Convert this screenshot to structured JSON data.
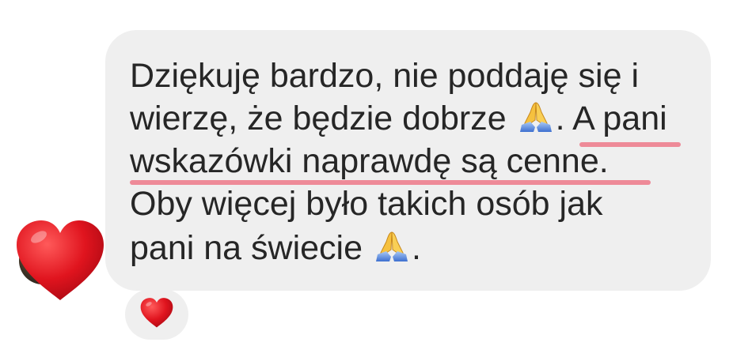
{
  "message": {
    "line1": "Dziękuję bardzo, nie poddaję się i",
    "line2_before": "wierzę, że będzie dobrze ",
    "line2_after": ". A pani",
    "line3": "wskazówki naprawdę są cenne.",
    "line4": "Oby więcej było takich osób jak",
    "line5_before": "pani na świecie ",
    "line5_after": ".",
    "emoji": "folded-hands-emoji"
  },
  "reaction": {
    "emoji": "red-heart-icon"
  },
  "sticker": {
    "emoji": "red-heart-icon"
  },
  "colors": {
    "bubble": "#efefef",
    "text": "#262626",
    "highlight": "#ee8a98",
    "heart": "#e0141e"
  }
}
